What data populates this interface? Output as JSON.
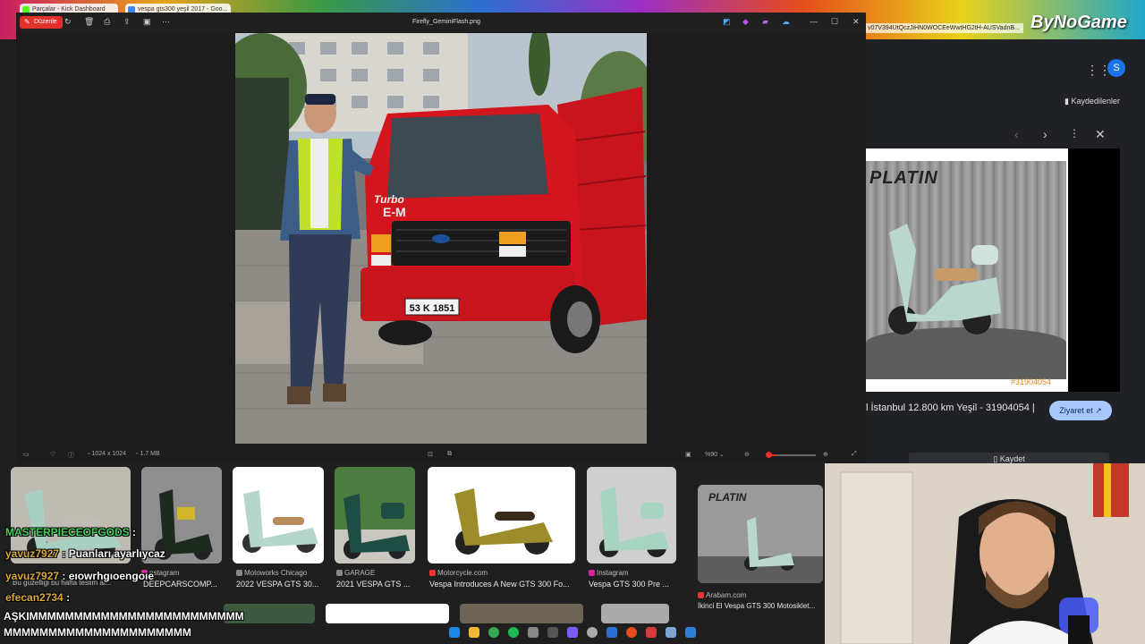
{
  "browser": {
    "tabs": [
      {
        "label": "Parçalar - Kick Dashboard"
      },
      {
        "label": "vespa gts300 yeşil 2017 - Goo..."
      }
    ],
    "url_fragment": "v07V394UtQczJiHN0WOCEeWwtHG2tH-AUSVadnB...",
    "brand": "ByNoGame"
  },
  "viewer": {
    "edit_label": "Düzenle",
    "filename": "Firefly_GeminiFlash.png",
    "dimensions": "1024 x 1024",
    "filesize": "1.7 MB",
    "zoom": "%90",
    "plate": "53 K 1851",
    "truck_badge": "Turbo E-M"
  },
  "google_panel": {
    "saved_label": "Kaydedilenler",
    "avatar_letter": "S",
    "logo_text": "PLATIN",
    "image_tag": "#31904054",
    "caption": "l İstanbul 12.800 km Yeşil - 31904054 |",
    "visit_label": "Ziyaret et",
    "save_label": "Kaydet"
  },
  "results": [
    {
      "source": "nstagram",
      "title": "DEEPCARSCOMP..."
    },
    {
      "source": "Motoworks Chicago",
      "title": "2022 VESPA GTS 30..."
    },
    {
      "source": "GARAGE",
      "title": "2021 VESPA GTS ..."
    },
    {
      "source": "Motorcycle.com",
      "title": "Vespa Introduces A New GTS 300 Fo..."
    },
    {
      "source": "Instagram",
      "title": "Vespa GTS 300 Pre ..."
    },
    {
      "source": "Arabam.com",
      "title": "İkinci El Vespa GTS 300 Motosiklet..."
    }
  ],
  "chat": [
    {
      "user": "MASTERPIECEOFGODS",
      "text": ":",
      "color": "#3fd25a"
    },
    {
      "user": "yavuz7927",
      "text": ": Puanları ayarlıycaz",
      "color": "#d9a93b"
    },
    {
      "user": "yavuz7927",
      "text": ": eıowrhgıoengoıe",
      "color": "#d9a93b"
    },
    {
      "user": "efecan2734",
      "text": ":",
      "color": "#d9a93b"
    },
    {
      "user": "",
      "text": "AŞKIMMMMMMMMMMMMMMMMMMMMMMMM",
      "color": "#ffffff"
    },
    {
      "user": "",
      "text": "MMMMMMMMMMMMMMMMMMMMM",
      "color": "#ffffff"
    }
  ],
  "chat_ghost": "Bu güzelliği bu hafta teslim al..."
}
